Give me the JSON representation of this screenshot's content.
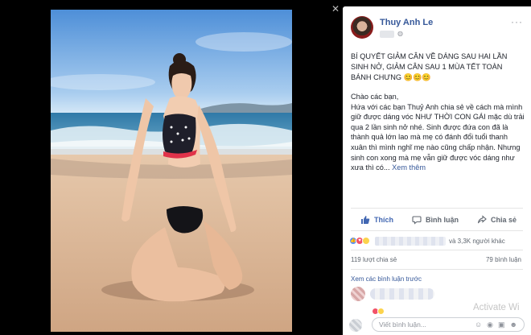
{
  "post": {
    "author": "Thuy Anh Le",
    "title": "BÍ QUYẾT GIẢM CÂN VỀ DÁNG SAU HAI LẦN SINH NỞ, GIẢM CÂN SAU 1 MÙA TẾT TOÀN BÁNH CHƯNG",
    "title_emojis": "😊😊😊",
    "greeting": "Chào các bạn,",
    "body": "Hứa với các bạn Thuỷ Anh chia sẻ về cách mà mình giữ được dáng vóc NHƯ THỜI CON GÁI mặc dù trải qua 2 lần sinh nở nhé. Sinh được đứa con đã là thành quả lớn lao mà mẹ có đánh đổi tuổi thanh xuân thì mình nghĩ mẹ nào cũng chấp nhận. Nhưng sinh con xong mà mẹ vẫn giữ được vóc dáng như xưa thì có...",
    "see_more": "Xem thêm"
  },
  "actions": {
    "like": "Thích",
    "comment": "Bình luận",
    "share": "Chia sẻ"
  },
  "reactions": {
    "summary_suffix": "và 3,3K người khác"
  },
  "stats": {
    "shares": "119 lượt chia sẻ",
    "comments": "79 bình luận"
  },
  "comments": {
    "view_previous": "Xem các bình luận trước",
    "input_placeholder": "Viết bình luận..."
  },
  "overlay": {
    "watermark": "Activate Wi"
  },
  "icons": [
    "close-icon",
    "globe-icon",
    "more-options-icon",
    "like-icon",
    "comment-icon",
    "share-icon",
    "camera-icon",
    "gif-icon",
    "sticker-icon",
    "emoji-icon"
  ],
  "colors": {
    "link_blue": "#365899",
    "like_blue": "#4267b2",
    "panel_bg": "#ffffff",
    "viewer_bg": "#000000"
  }
}
